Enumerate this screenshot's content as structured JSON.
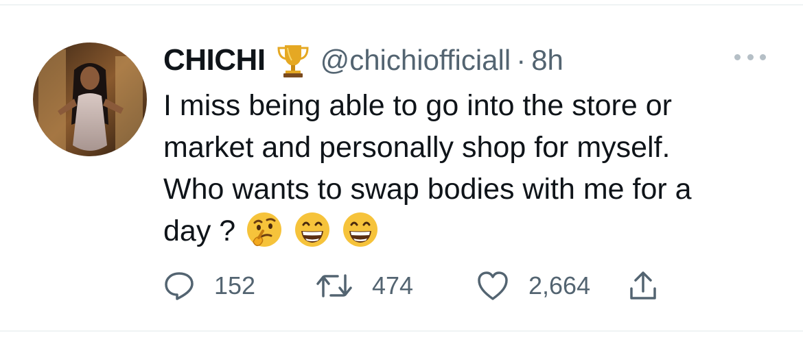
{
  "tweet": {
    "display_name": "CHICHI",
    "badge_icon": "trophy-icon",
    "handle": "@chichiofficiall",
    "separator": "·",
    "time": "8h",
    "text_lines": [
      "I miss being able to go into the store or",
      "market and personally shop for myself.",
      "Who wants to swap bodies with me for a",
      "day ?"
    ],
    "emojis": [
      "thinking-face-emoji",
      "grinning-face-emoji",
      "grinning-face-emoji"
    ],
    "stats": {
      "replies": "152",
      "retweets": "474",
      "likes": "2,664"
    }
  },
  "colors": {
    "text_primary": "#0f1419",
    "text_secondary": "#536471",
    "divider": "#eff3f4",
    "more_dots": "#b5bfc6"
  }
}
